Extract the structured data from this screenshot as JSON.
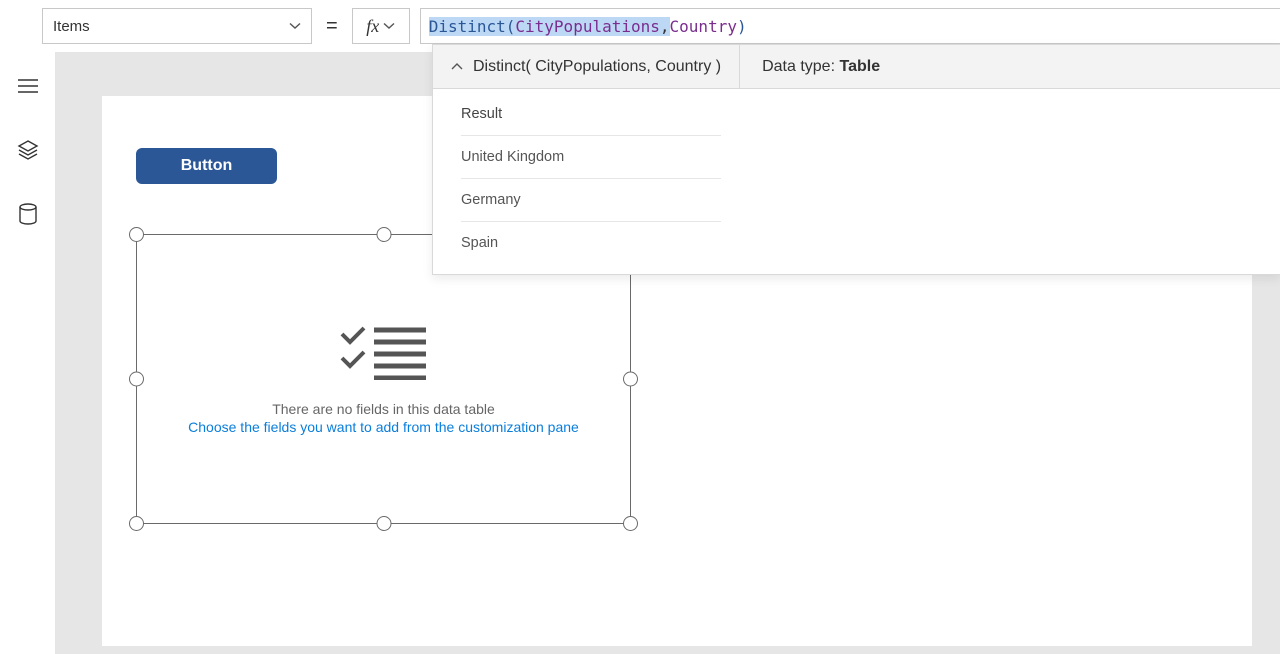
{
  "property_selector": {
    "value": "Items"
  },
  "formula": {
    "tokens": [
      {
        "text": "Distinct( ",
        "cls": "tok-fn",
        "hl": true
      },
      {
        "text": "CityPopulations",
        "cls": "tok-id",
        "hl": true
      },
      {
        "text": ", ",
        "cls": "tok-p",
        "hl": true
      },
      {
        "text": "Country ",
        "cls": "tok-id",
        "hl": false
      },
      {
        "text": ")",
        "cls": "tok-fn",
        "hl": false
      }
    ]
  },
  "fx_panel": {
    "expression": "Distinct( CityPopulations, Country )",
    "datatype_label": "Data type:",
    "datatype_value": "Table",
    "rows": [
      "Result",
      "United Kingdom",
      "Germany",
      "Spain"
    ]
  },
  "canvas": {
    "button_label": "Button",
    "datatable_empty_line1": "There are no fields in this data table",
    "datatable_empty_line2": "Choose the fields you want to add from the customization pane"
  },
  "icons": {
    "menu": "menu-icon",
    "layers": "layers-icon",
    "data": "data-icon"
  }
}
